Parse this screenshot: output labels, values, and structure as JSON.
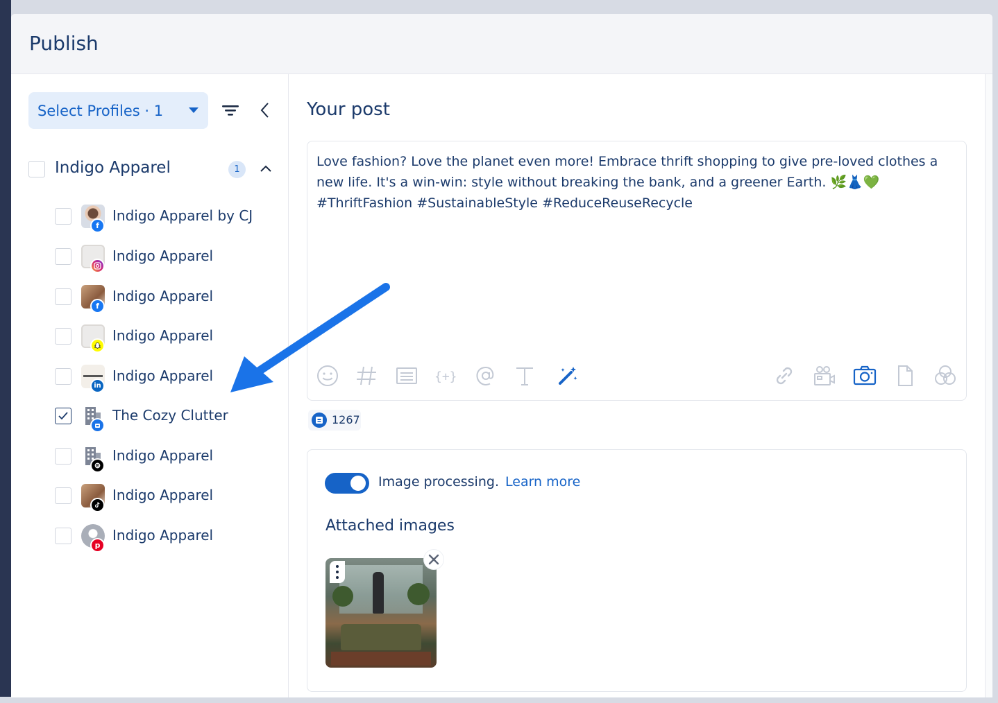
{
  "modal": {
    "title": "Publish"
  },
  "profiles": {
    "select_label": "Select Profiles · 1",
    "group": {
      "name": "Indigo Apparel",
      "count": "1",
      "checked": false
    },
    "items": [
      {
        "name": "Indigo Apparel by CJ",
        "network": "facebook",
        "checked": false
      },
      {
        "name": "Indigo Apparel",
        "network": "instagram",
        "checked": false
      },
      {
        "name": "Indigo Apparel",
        "network": "facebook",
        "checked": false
      },
      {
        "name": "Indigo Apparel",
        "network": "snapchat",
        "checked": false
      },
      {
        "name": "Indigo Apparel",
        "network": "linkedin",
        "checked": false
      },
      {
        "name": "The Cozy Clutter",
        "network": "google-business",
        "checked": true
      },
      {
        "name": "Indigo Apparel",
        "network": "threads",
        "checked": false
      },
      {
        "name": "Indigo Apparel",
        "network": "tiktok",
        "checked": false
      },
      {
        "name": "Indigo Apparel",
        "network": "pinterest",
        "checked": false
      }
    ]
  },
  "post": {
    "title": "Your post",
    "text_line1": "Love fashion? Love the planet even more! Embrace thrift shopping to give pre-loved clothes a",
    "text_line2": "new life. It's a win-win: style without breaking the bank, and a greener Earth. 🌿👗💚",
    "text_line3": "#ThriftFashion #SustainableStyle #ReduceReuseRecycle",
    "char_count": "1267"
  },
  "toolbar": {
    "left": [
      "emoji-icon",
      "hashtag-icon",
      "snippets-icon",
      "variables-icon",
      "mention-icon",
      "text-format-icon",
      "ai-assist-icon"
    ],
    "right": [
      "link-icon",
      "video-icon",
      "camera-icon",
      "document-icon",
      "overlay-icon"
    ]
  },
  "media": {
    "toggle_label": "Image processing.",
    "toggle_on": true,
    "learn_more": "Learn more",
    "attached_title": "Attached images"
  },
  "colors": {
    "accent": "#1663c7",
    "text": "#1b3a6b",
    "facebook": "#1877f2",
    "linkedin": "#0a66c2",
    "pinterest": "#e60023",
    "snapchat": "#fffc00",
    "arrow": "#1a73e8"
  }
}
